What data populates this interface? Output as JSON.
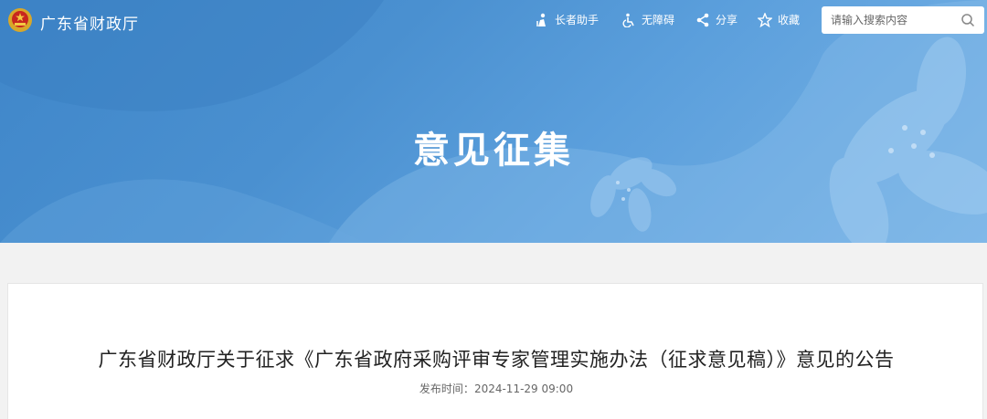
{
  "header": {
    "site_name": "广东省财政厅",
    "tools": [
      {
        "label": "长者助手",
        "icon": "elder-assist-icon"
      },
      {
        "label": "无障碍",
        "icon": "accessibility-icon"
      },
      {
        "label": "分享",
        "icon": "share-icon"
      },
      {
        "label": "收藏",
        "icon": "star-icon"
      }
    ],
    "search": {
      "placeholder": "请输入搜索内容",
      "icon": "search-icon"
    }
  },
  "banner": {
    "title": "意见征集"
  },
  "article": {
    "title": "广东省财政厅关于征求《广东省政府采购评审专家管理实施办法（征求意见稿）》意见的公告",
    "publish_label": "发布时间：",
    "publish_time": "2024-11-29 09:00"
  },
  "colors": {
    "accent": "#4a90d0",
    "text": "#222222",
    "muted": "#666666"
  }
}
